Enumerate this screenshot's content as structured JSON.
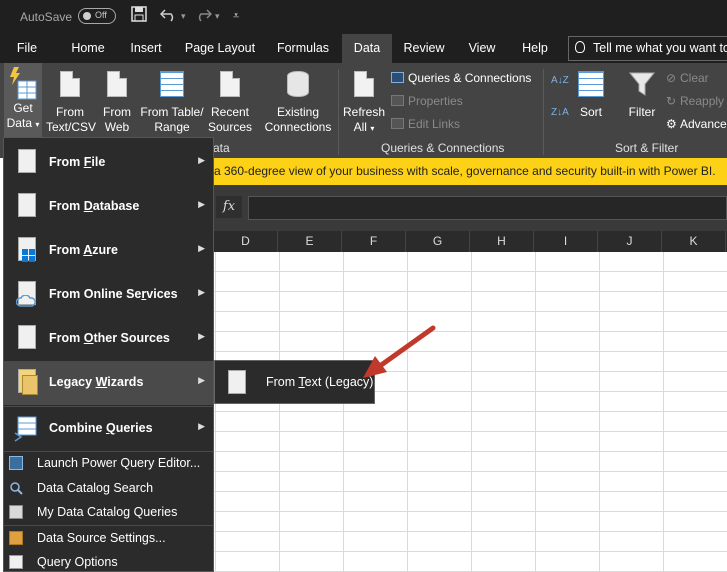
{
  "titlebar": {
    "autosave": "AutoSave",
    "toggle": "Off"
  },
  "tabs": [
    "File",
    "Home",
    "Insert",
    "Page Layout",
    "Formulas",
    "Data",
    "Review",
    "View",
    "Help"
  ],
  "tellme": "Tell me what you want to",
  "ribbon": {
    "get_data": [
      "Get",
      "Data"
    ],
    "from_text_csv": [
      "From",
      "Text/CSV"
    ],
    "from_web": [
      "From",
      "Web"
    ],
    "from_table": [
      "From Table/",
      "Range"
    ],
    "recent_sources": [
      "Recent",
      "Sources"
    ],
    "existing_connections": [
      "Existing",
      "Connections"
    ],
    "refresh_all": [
      "Refresh",
      "All"
    ],
    "queries_connections": "Queries & Connections",
    "properties": "Properties",
    "edit_links": "Edit Links",
    "group_queries": "Queries & Connections",
    "group_get_fragment": "ata",
    "sort": "Sort",
    "filter": "Filter",
    "clear": "Clear",
    "reapply": "Reapply",
    "advanced": "Advance",
    "group_sort_filter": "Sort & Filter"
  },
  "infobar": "a 360-degree view of your business with scale, governance and security built-in with Power BI.",
  "formula": {
    "fx": "fx"
  },
  "columns": [
    "D",
    "E",
    "F",
    "G",
    "H",
    "I",
    "J",
    "K"
  ],
  "menu": {
    "items": [
      {
        "pre": "From ",
        "key": "F",
        "post": "ile"
      },
      {
        "pre": "From ",
        "key": "D",
        "post": "atabase"
      },
      {
        "pre": "From ",
        "key": "A",
        "post": "zure"
      },
      {
        "pre": "From Online Se",
        "key": "r",
        "post": "vices"
      },
      {
        "pre": "From ",
        "key": "O",
        "post": "ther Sources"
      },
      {
        "pre": "Legacy ",
        "key": "W",
        "post": "izards"
      },
      {
        "pre": "Combine ",
        "key": "Q",
        "post": "ueries"
      }
    ],
    "small": [
      "Launch Power Query Editor...",
      "Data Catalog Search",
      "My Data Catalog Queries",
      "Data Source Settings...",
      "Query Options"
    ]
  },
  "submenu": {
    "pre": "From ",
    "key": "T",
    "post": "ext (Legacy)"
  },
  "colors": {
    "accent": "#fcd116",
    "arrow": "#c0392b"
  }
}
